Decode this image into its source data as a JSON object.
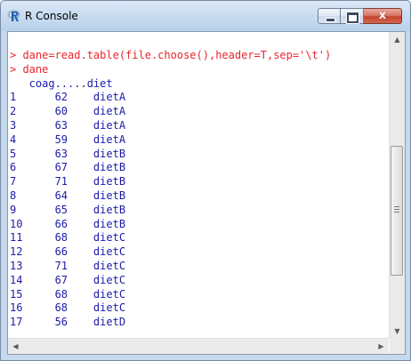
{
  "window": {
    "title": "R Console",
    "app_icon": "r-logo-icon"
  },
  "caption_buttons": {
    "minimize_icon": "minimize-icon",
    "maximize_icon": "maximize-icon",
    "close_icon": "close-icon",
    "close_glyph": "x"
  },
  "console": {
    "lines": [
      {
        "kind": "cmd",
        "text": "> dane=read.table(file.choose(),header=T,sep='\\t')"
      },
      {
        "kind": "cmd",
        "text": "> dane"
      },
      {
        "kind": "out",
        "text": "   coag.....diet"
      },
      {
        "kind": "out",
        "text": "1      62    dietA"
      },
      {
        "kind": "out",
        "text": "2      60    dietA"
      },
      {
        "kind": "out",
        "text": "3      63    dietA"
      },
      {
        "kind": "out",
        "text": "4      59    dietA"
      },
      {
        "kind": "out",
        "text": "5      63    dietB"
      },
      {
        "kind": "out",
        "text": "6      67    dietB"
      },
      {
        "kind": "out",
        "text": "7      71    dietB"
      },
      {
        "kind": "out",
        "text": "8      64    dietB"
      },
      {
        "kind": "out",
        "text": "9      65    dietB"
      },
      {
        "kind": "out",
        "text": "10     66    dietB"
      },
      {
        "kind": "out",
        "text": "11     68    dietC"
      },
      {
        "kind": "out",
        "text": "12     66    dietC"
      },
      {
        "kind": "out",
        "text": "13     71    dietC"
      },
      {
        "kind": "out",
        "text": "14     67    dietC"
      },
      {
        "kind": "out",
        "text": "15     68    dietC"
      },
      {
        "kind": "out",
        "text": "16     68    dietC"
      },
      {
        "kind": "out",
        "text": "17     56    dietD"
      }
    ]
  },
  "scrollbars": {
    "up_icon": "arrow-up-icon",
    "down_icon": "arrow-down-icon",
    "left_icon": "arrow-left-icon",
    "right_icon": "arrow-right-icon",
    "up_glyph": "▲",
    "down_glyph": "▼",
    "left_glyph": "◀",
    "right_glyph": "▶"
  }
}
